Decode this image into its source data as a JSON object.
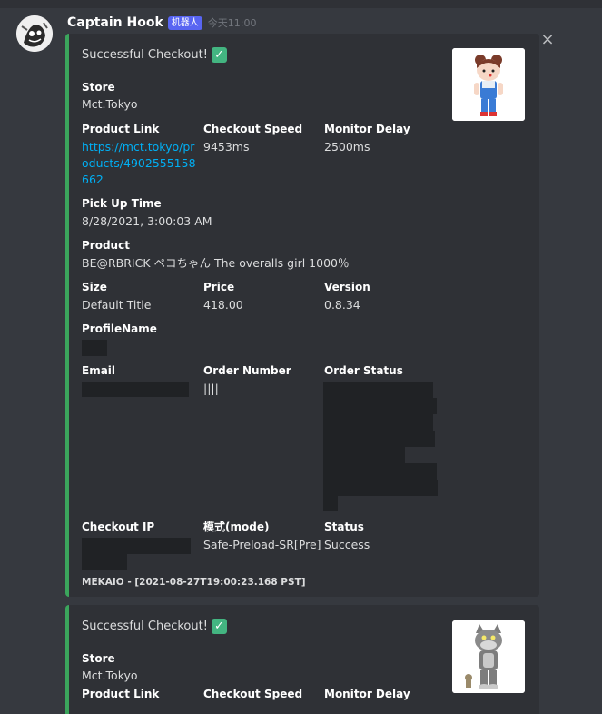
{
  "message": {
    "author": "Captain Hook",
    "bot_tag": "机器人",
    "timestamp": "今天11:00",
    "close_icon": "×"
  },
  "embed1": {
    "title": "Successful Checkout!",
    "check_icon": "✓",
    "thumbnail": "bearbrick-peko-chan-figure",
    "store_label": "Store",
    "store_value": "Mct.Tokyo",
    "product_link_label": "Product Link",
    "product_link_value": "https://mct.tokyo/products/4902555158662",
    "checkout_speed_label": "Checkout Speed",
    "checkout_speed_value": "9453ms",
    "monitor_delay_label": "Monitor Delay",
    "monitor_delay_value": "2500ms",
    "pickup_label": "Pick Up Time",
    "pickup_value": "8/28/2021, 3:00:03 AM",
    "product_label": "Product",
    "product_value": "BE@RBRICK ペコちゃん The overalls girl 1000％",
    "size_label": "Size",
    "size_value": "Default Title",
    "price_label": "Price",
    "price_value": "418.00",
    "version_label": "Version",
    "version_value": "0.8.34",
    "profile_label": "ProfileName",
    "email_label": "Email",
    "order_number_label": "Order Number",
    "order_number_value": "||||",
    "order_status_label": "Order Status",
    "checkout_ip_label": "Checkout IP",
    "mode_label": "模式(mode)",
    "mode_value": "Safe-Preload-SR[Pre]",
    "status_label": "Status",
    "status_value": "Success",
    "footer": "MEKAIO - [2021-08-27T19:00:23.168 PST]"
  },
  "embed2": {
    "title": "Successful Checkout!",
    "check_icon": "✓",
    "thumbnail": "bearbrick-tom-figure",
    "store_label": "Store",
    "store_value": "Mct.Tokyo",
    "product_link_label": "Product Link",
    "checkout_speed_label": "Checkout Speed",
    "monitor_delay_label": "Monitor Delay"
  },
  "colors": {
    "background": "#36393f",
    "embed_bg": "#2f3136",
    "embed_accent": "#3ba55c",
    "link": "#00aff4",
    "bot_tag": "#5865f2"
  }
}
